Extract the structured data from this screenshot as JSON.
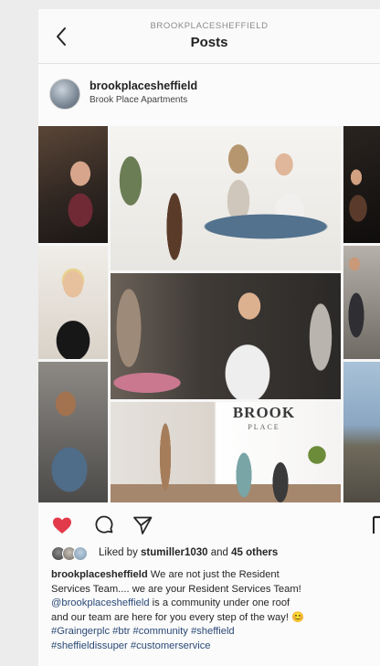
{
  "header": {
    "account_small": "BROOKPLACESHEFFIELD",
    "title": "Posts"
  },
  "post": {
    "username": "brookplacesheffield",
    "location": "Brook Place Apartments",
    "photo_sign": {
      "line1": "BROOK",
      "line2": "PLACE"
    },
    "likes": {
      "prefix": "Liked by ",
      "user": "stumiller1030",
      "middle": " and ",
      "count": "45 others"
    },
    "caption": {
      "username": "brookplacesheffield",
      "line1": " We are not just the Resident",
      "line2": "Services Team.... we are your Resident Services Team!",
      "mention": "@brookplacesheffield",
      "line3_rest": " is a community under one roof",
      "line4": "and our team are here for you every step of the way! 😊",
      "hashtags_line1": "#Graingerplc #btr #community #sheffield",
      "hashtags_line2": "#sheffieldissuper #customerservice"
    }
  },
  "icons": {
    "back": "chevron-left-icon",
    "like": "heart-filled-icon",
    "comment": "comment-bubble-icon",
    "share": "paper-plane-icon",
    "save": "bookmark-icon"
  },
  "colors": {
    "like_red": "#e23a4b",
    "link_blue": "#2b4a77",
    "text": "#262626"
  }
}
